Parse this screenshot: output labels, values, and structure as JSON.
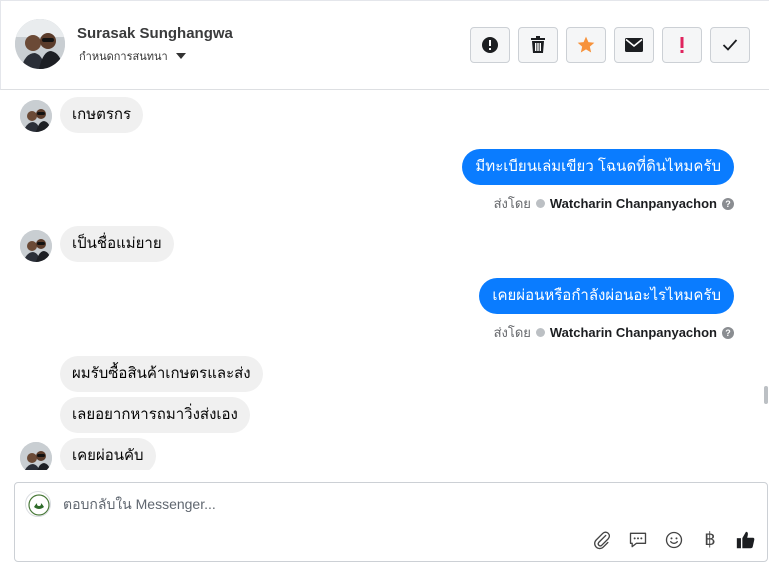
{
  "header": {
    "contact_name": "Surasak Sunghangwa",
    "assign_label": "กำหนดการสนทนา",
    "actions": [
      {
        "name": "spam-button",
        "icon": "alert-circle-icon"
      },
      {
        "name": "delete-button",
        "icon": "trash-icon"
      },
      {
        "name": "star-button",
        "icon": "star-icon"
      },
      {
        "name": "mark-unread-button",
        "icon": "envelope-icon"
      },
      {
        "name": "follow-up-button",
        "icon": "exclamation-icon"
      },
      {
        "name": "mark-done-button",
        "icon": "checkmark-icon"
      }
    ],
    "star_color": "#f7923b",
    "follow_up_color": "#e0245e"
  },
  "messages": [
    {
      "direction": "in",
      "text": "เกษตรกร"
    },
    {
      "direction": "out",
      "text": "มีทะเบียนเล่มเขียว โฉนดที่ดินไหมครับ",
      "sent_by_label": "ส่งโดย",
      "sender": "Watcharin Chanpanyachon"
    },
    {
      "direction": "in",
      "text": "เป็นชื่อแม่ยาย"
    },
    {
      "direction": "out",
      "text": "เคยผ่อนหรือกำลังผ่อนอะไรไหมครับ",
      "sent_by_label": "ส่งโดย",
      "sender": "Watcharin Chanpanyachon"
    },
    {
      "direction": "in",
      "text": "ผมรับซื้อสินค้าเกษตรและส่ง"
    },
    {
      "direction": "in",
      "text": "เลยอยากหารถมาวิ่งส่งเอง"
    },
    {
      "direction": "in",
      "text": "เคยผ่อนคับ"
    }
  ],
  "composer": {
    "placeholder": "ตอบกลับใน Messenger...",
    "value": "",
    "tools": [
      "paperclip-icon",
      "saved-reply-icon",
      "emoji-icon",
      "baht-payment-icon",
      "thumbs-up-icon"
    ],
    "baht_symbol": "฿"
  },
  "colors": {
    "outgoing_bubble": "#0a7cff",
    "incoming_bubble": "#f0f0f0"
  }
}
